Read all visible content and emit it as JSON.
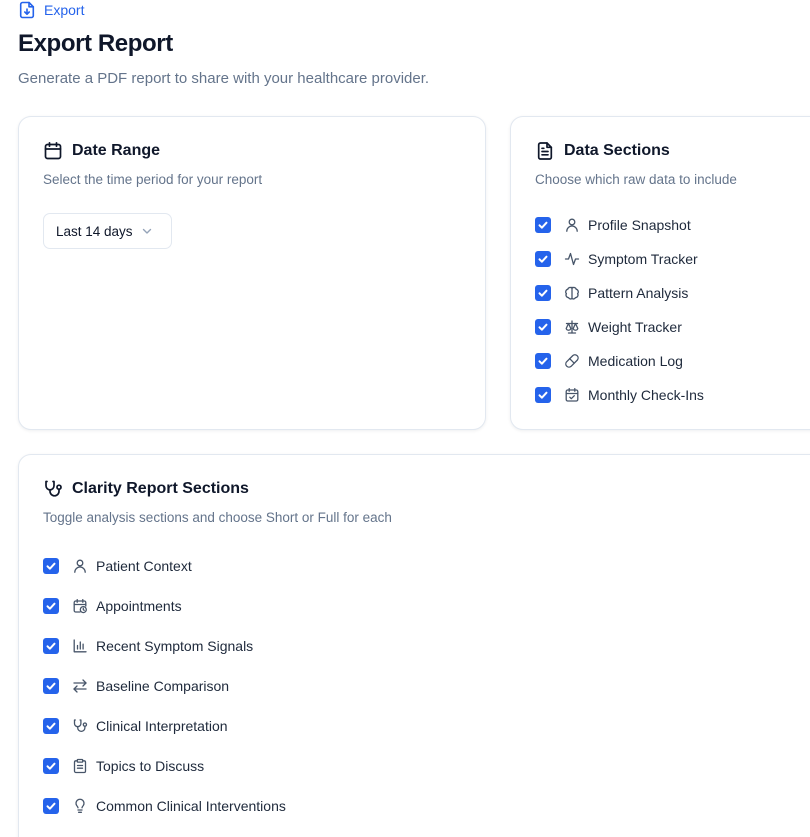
{
  "breadcrumb": {
    "label": "Export",
    "icon": "file-download-icon"
  },
  "page": {
    "title": "Export Report",
    "subtitle": "Generate a PDF report to share with your healthcare provider."
  },
  "date_range": {
    "title": "Date Range",
    "description": "Select the time period for your report",
    "icon": "calendar-icon",
    "selected": "Last 14 days"
  },
  "data_sections": {
    "title": "Data Sections",
    "description": "Choose which raw data to include",
    "icon": "document-icon",
    "items": [
      {
        "label": "Profile Snapshot",
        "checked": true,
        "icon": "user-icon"
      },
      {
        "label": "Symptom Tracker",
        "checked": true,
        "icon": "activity-icon"
      },
      {
        "label": "Pattern Analysis",
        "checked": true,
        "icon": "brain-icon"
      },
      {
        "label": "Weight Tracker",
        "checked": true,
        "icon": "scale-icon"
      },
      {
        "label": "Medication Log",
        "checked": true,
        "icon": "pill-icon"
      },
      {
        "label": "Monthly Check-Ins",
        "checked": true,
        "icon": "calendar-check-icon"
      }
    ]
  },
  "clarity_sections": {
    "title": "Clarity Report Sections",
    "description": "Toggle analysis sections and choose Short or Full for each",
    "icon": "stethoscope-icon",
    "items": [
      {
        "label": "Patient Context",
        "checked": true,
        "icon": "user-icon"
      },
      {
        "label": "Appointments",
        "checked": true,
        "icon": "calendar-clock-icon"
      },
      {
        "label": "Recent Symptom Signals",
        "checked": true,
        "icon": "bar-chart-icon"
      },
      {
        "label": "Baseline Comparison",
        "checked": true,
        "icon": "arrows-swap-icon"
      },
      {
        "label": "Clinical Interpretation",
        "checked": true,
        "icon": "stethoscope-icon"
      },
      {
        "label": "Topics to Discuss",
        "checked": true,
        "icon": "clipboard-icon"
      },
      {
        "label": "Common Clinical Interventions",
        "checked": true,
        "icon": "lightbulb-icon"
      }
    ]
  },
  "colors": {
    "accent": "#2563eb",
    "text": "#0f172a",
    "muted": "#64748b",
    "border": "#e2e8f0"
  }
}
